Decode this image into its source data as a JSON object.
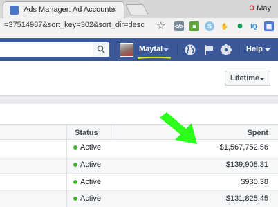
{
  "browser": {
    "tab_title": "Ads Manager: Ad Accounts",
    "close_glyph": "×",
    "profile_name": "May",
    "profile_glyph": "Ɔ",
    "url": "=37514987&sort_key=302&sort_dir=desc",
    "star_glyph": "☆",
    "extensions": [
      {
        "name": "code-extension-icon",
        "color": "#7b8a9a",
        "glyph": "</>"
      },
      {
        "name": "extension-green-icon",
        "color": "#5aa63b",
        "glyph": "■"
      },
      {
        "name": "skype-icon",
        "color": "#8fc6e8",
        "glyph": "S"
      },
      {
        "name": "hand-icon",
        "color": "#b9b9b9",
        "glyph": "✋"
      },
      {
        "name": "hangouts-icon",
        "color": "#0f9d58",
        "glyph": "●"
      },
      {
        "name": "iq-icon",
        "color": "#2c8bd6",
        "glyph": "IQ"
      },
      {
        "name": "dashboard-icon",
        "color": "#4a74d6",
        "glyph": "▦"
      }
    ]
  },
  "fb_header": {
    "username": "Maytal",
    "help_label": "Help",
    "bar_color": "#3b5998"
  },
  "toolbar": {
    "date_range_label": "Lifetime"
  },
  "table": {
    "columns": {
      "status": "Status",
      "spent": "Spent"
    },
    "rows": [
      {
        "status": "Active",
        "spent": "$1,567,752.56"
      },
      {
        "status": "Active",
        "spent": "$139,908.31"
      },
      {
        "status": "Active",
        "spent": "$930.38"
      },
      {
        "status": "Active",
        "spent": "$131,825.45"
      }
    ]
  },
  "annotation": {
    "arrow_color": "#2bff1a",
    "underline_color": "#e8f000"
  }
}
